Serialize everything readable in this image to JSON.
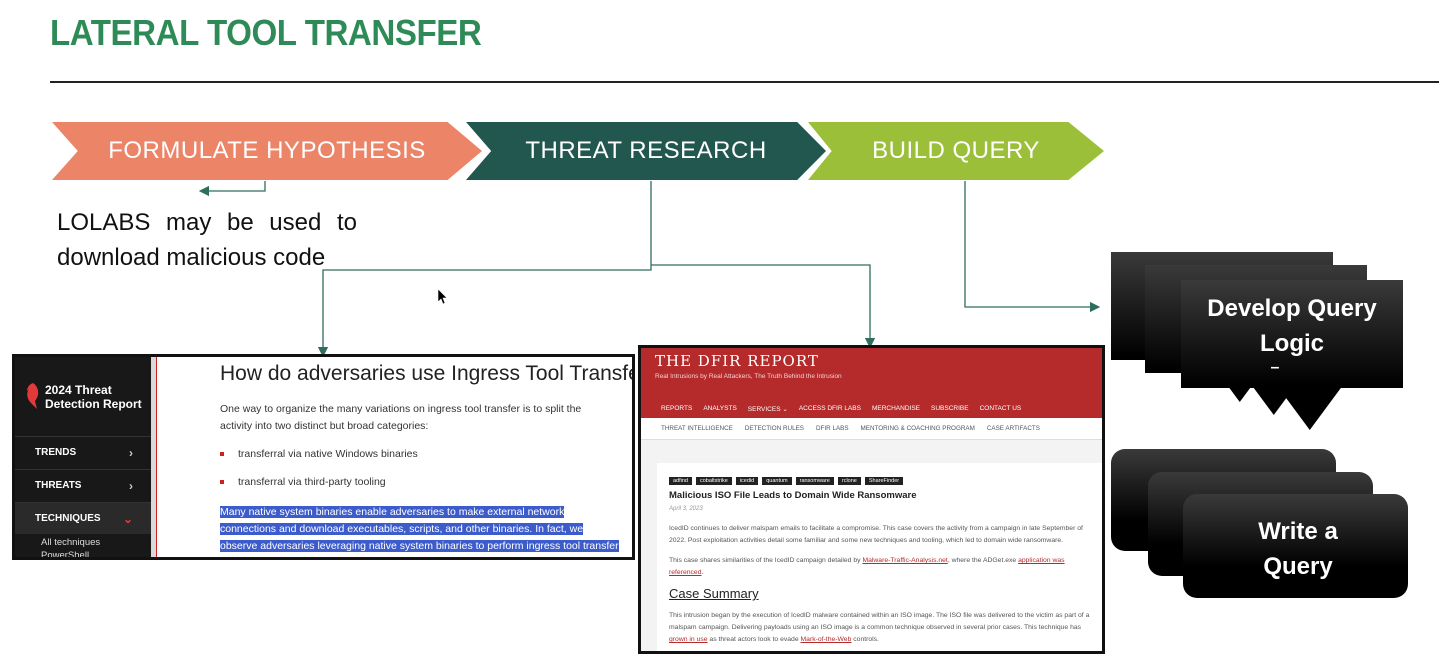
{
  "slide": {
    "title": "LATERAL TOOL TRANSFER"
  },
  "process": {
    "steps": [
      {
        "label": "FORMULATE HYPOTHESIS",
        "color": "#ec8468"
      },
      {
        "label": "THREAT RESEARCH",
        "color": "#21574f"
      },
      {
        "label": "BUILD QUERY",
        "color": "#9cbf3a"
      }
    ],
    "hypothesis_text": "LOLABS may be used to download malicious code"
  },
  "research1": {
    "logo_text": "2024 Threat Detection Report",
    "nav": [
      {
        "label": "TRENDS"
      },
      {
        "label": "THREATS"
      },
      {
        "label": "TECHNIQUES"
      }
    ],
    "sub_items": [
      "All techniques",
      "PowerShell"
    ],
    "heading": "How do adversaries use Ingress Tool Transfer?",
    "intro": "One way to organize the many variations on ingress tool transfer is to split the activity into two distinct but broad categories:",
    "bullets": [
      "transferral via native Windows binaries",
      "transferral via third-party tooling"
    ],
    "highlight": "Many native system binaries enable adversaries to make external network connections and download executables, scripts, and other binaries. In fact, we observe adversaries leveraging native system binaries to perform ingress tool transfer far more often than not."
  },
  "research2": {
    "site_name": "THE DFIR REPORT",
    "tagline": "Real Intrusions by Real Attackers, The Truth Behind the Intrusion",
    "menu": [
      "REPORTS",
      "ANALYSTS",
      "SERVICES ⌄",
      "ACCESS DFIR LABS",
      "MERCHANDISE",
      "SUBSCRIBE",
      "CONTACT US"
    ],
    "submenu": [
      "THREAT INTELLIGENCE",
      "DETECTION RULES",
      "DFIR LABS",
      "MENTORING & COACHING PROGRAM",
      "CASE ARTIFACTS"
    ],
    "tags": [
      "adfind",
      "cobaltstrike",
      "icedid",
      "quantum",
      "ransomware",
      "rclone",
      "ShareFinder"
    ],
    "article_title": "Malicious ISO File Leads to Domain Wide Ransomware",
    "date": "April 3, 2023",
    "para1": "IcedID continues to deliver malspam emails to facilitate a compromise. This case covers the activity from a campaign in late September of 2022. Post exploitation activities detail some familiar and some new techniques and tooling, which led to  domain wide ransomware.",
    "para2_prefix": "This case shares similarities of the IcedID campaign detailed by ",
    "para2_link1": "Malware-Traffic-Analysis.net",
    "para2_mid": ", where the ADGet.exe ",
    "para2_link2": "application was referenced",
    "para2_suffix": ".",
    "case_summary": "Case Summary",
    "para3_prefix": "This intrusion began by the execution of IcedID malware contained within an ISO image. The ISO file was delivered to the victim as part of a malspam campaign. Delivering payloads using an ISO image is a common technique observed in several prior cases. This technique has ",
    "para3_link1": "grown in use",
    "para3_mid": " as threat actors look to evade ",
    "para3_link2": "Mark-of-the-Web",
    "para3_suffix": " controls."
  },
  "build": {
    "card1_label": "Develop Query Logic",
    "card1_dash": "–",
    "card2_label": "Write a Query"
  }
}
